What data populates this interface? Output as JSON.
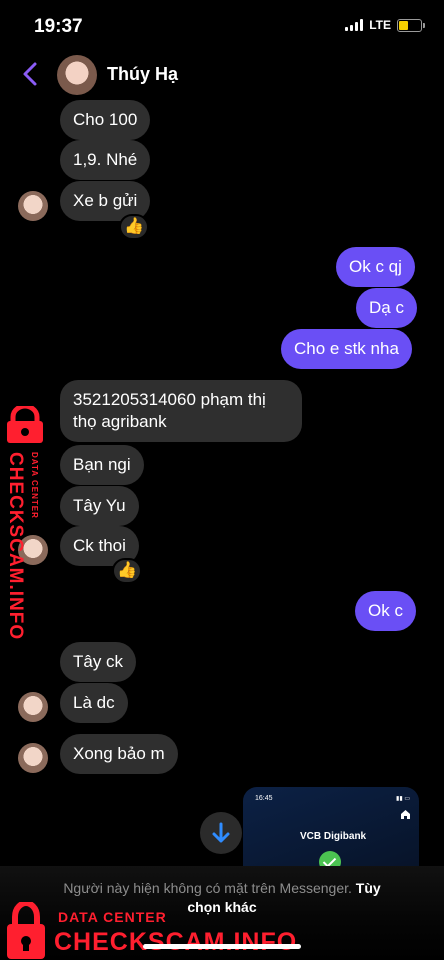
{
  "status": {
    "time": "19:37",
    "network": "LTE"
  },
  "header": {
    "name": "Thúy Hạ"
  },
  "messages": [
    {
      "text": "Cho 100"
    },
    {
      "text": "1,9. Nhé"
    },
    {
      "text": "Xe b gửi"
    },
    {
      "text": "Ok c qj"
    },
    {
      "text": "Dạ c"
    },
    {
      "text": "Cho e stk nha"
    },
    {
      "text": "3521205314060 phạm thị thọ agribank"
    },
    {
      "text": "Bạn ngi"
    },
    {
      "text": "Tây Yu"
    },
    {
      "text": "Ck thoi"
    },
    {
      "text": "Ok c"
    },
    {
      "text": "Tây ck"
    },
    {
      "text": "Là dc"
    },
    {
      "text": "Xong bảo m"
    }
  ],
  "reactions": {
    "first": "👍",
    "second": "👍"
  },
  "preview": {
    "time": "16:45",
    "brand": "VCB Digibank"
  },
  "notice": {
    "text": "Người này hiện không có mặt trên Messenger.",
    "link": "Tùy chọn khác"
  },
  "watermark": {
    "main": "CHECKSCAM.INFO",
    "sub": "DATA CENTER"
  },
  "colors": {
    "outgoing": "#6a4ff5",
    "incoming": "#2f2f2f",
    "accent": "#8b5cf6",
    "watermark": "#ff1f2f"
  },
  "icons": {
    "back": "chevron-left-icon",
    "scroll": "arrow-down-icon",
    "lock": "lock-icon"
  }
}
